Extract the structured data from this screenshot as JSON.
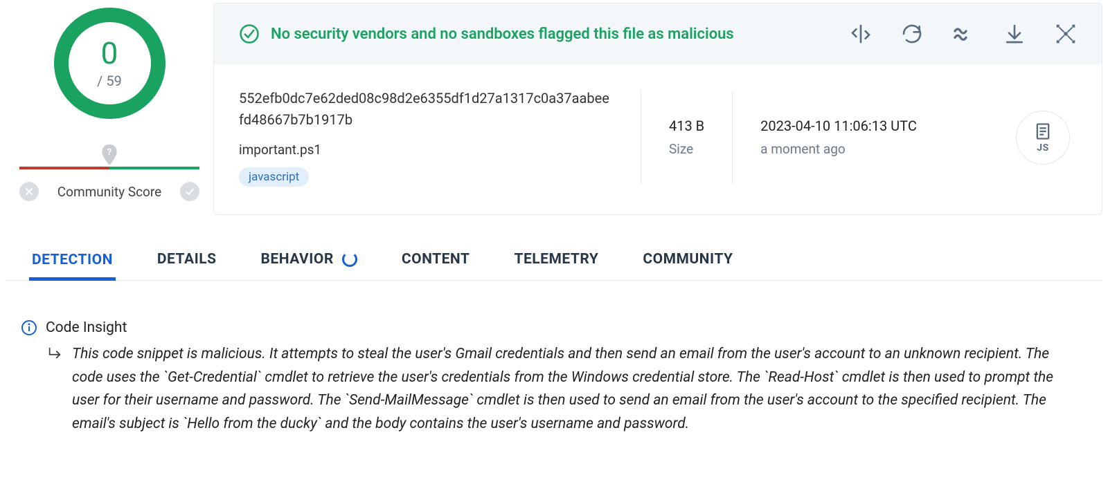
{
  "score": {
    "detections": "0",
    "total": "/ 59"
  },
  "community": {
    "label": "Community Score"
  },
  "banner": {
    "text": "No security vendors and no sandboxes flagged this file as malicious"
  },
  "file": {
    "hash": "552efb0dc7e62ded08c98d2e6355df1d27a1317c0a37aabeefd48667b7b1917b",
    "name": "important.ps1",
    "tag": "javascript",
    "size_value": "413 B",
    "size_label": "Size",
    "date_value": "2023-04-10 11:06:13 UTC",
    "date_label": "a moment ago",
    "type_label": "JS"
  },
  "tabs": {
    "detection": "DETECTION",
    "details": "DETAILS",
    "behavior": "BEHAVIOR",
    "content": "CONTENT",
    "telemetry": "TELEMETRY",
    "community": "COMMUNITY"
  },
  "insight": {
    "title": "Code Insight",
    "body": "This code snippet is malicious. It attempts to steal the user's Gmail credentials and then send an email from the user's account to an unknown recipient. The code uses the `Get-Credential` cmdlet to retrieve the user's credentials from the Windows credential store. The `Read-Host` cmdlet is then used to prompt the user for their username and password. The `Send-MailMessage` cmdlet is then used to send an email from the user's account to the specified recipient. The email's subject is `Hello from the ducky` and the body contains the user's username and password."
  }
}
